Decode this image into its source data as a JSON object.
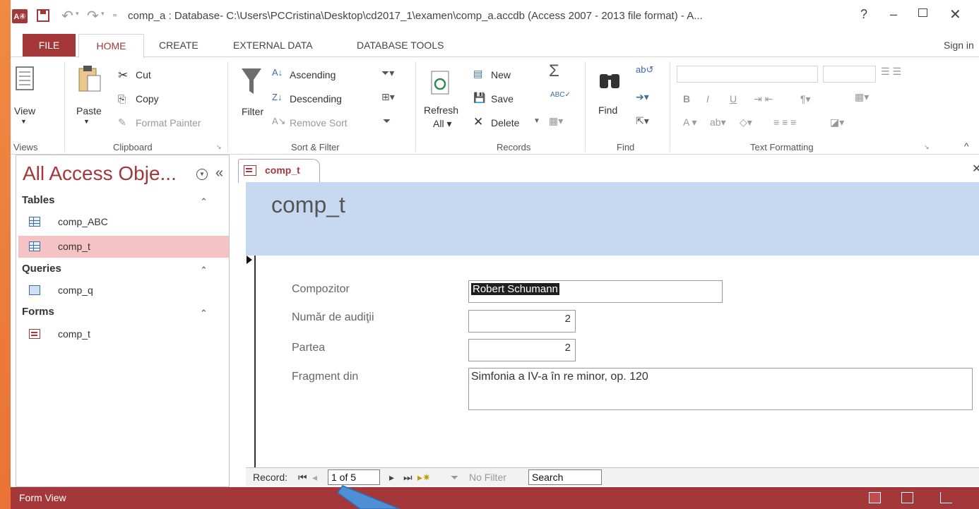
{
  "window": {
    "title": "comp_a : Database- C:\\Users\\PCCristina\\Desktop\\cd2017_1\\examen\\comp_a.accdb (Access 2007 - 2013 file format) - A...",
    "app_icon": "A④",
    "help": "?",
    "minimize": "–",
    "close": "✕"
  },
  "ribbon_tabs": {
    "file": "FILE",
    "home": "HOME",
    "create": "CREATE",
    "external": "EXTERNAL DATA",
    "dbtools": "DATABASE TOOLS",
    "sign_in": "Sign in"
  },
  "ribbon": {
    "views": {
      "label": "Views",
      "view": "View"
    },
    "clipboard": {
      "label": "Clipboard",
      "paste": "Paste",
      "cut": "Cut",
      "copy": "Copy",
      "format_painter": "Format Painter"
    },
    "sort_filter": {
      "label": "Sort & Filter",
      "filter": "Filter",
      "ascending": "Ascending",
      "descending": "Descending",
      "remove_sort": "Remove Sort"
    },
    "records": {
      "label": "Records",
      "refresh": "Refresh",
      "refresh_all": "All",
      "new": "New",
      "save": "Save",
      "delete": "Delete"
    },
    "find": {
      "label": "Find",
      "find": "Find"
    },
    "text_formatting": {
      "label": "Text Formatting",
      "bold": "B",
      "italic": "I",
      "underline": "U"
    }
  },
  "nav": {
    "title": "All Access Obje...",
    "groups": [
      {
        "header": "Tables",
        "items": [
          "comp_ABC",
          "comp_t"
        ]
      },
      {
        "header": "Queries",
        "items": [
          "comp_q"
        ]
      },
      {
        "header": "Forms",
        "items": [
          "comp_t"
        ]
      }
    ],
    "selected_item": "comp_t"
  },
  "document": {
    "tab_label": "comp_t",
    "form_title": "comp_t",
    "fields": {
      "compozitor": {
        "label": "Compozitor",
        "value": "Robert Schumann"
      },
      "numar": {
        "label": "Număr de audiţii",
        "value": "2"
      },
      "partea": {
        "label": "Partea",
        "value": "2"
      },
      "fragment": {
        "label": "Fragment din",
        "value": "Simfonia a IV-a în re minor, op. 120"
      }
    }
  },
  "record_nav": {
    "label": "Record:",
    "position": "1 of 5",
    "filter": "No Filter",
    "search": "Search"
  },
  "status": {
    "text": "Form View"
  },
  "colors": {
    "access_red": "#a4373a",
    "form_header": "#c6d9f0",
    "callout": "#4f8fd6"
  }
}
